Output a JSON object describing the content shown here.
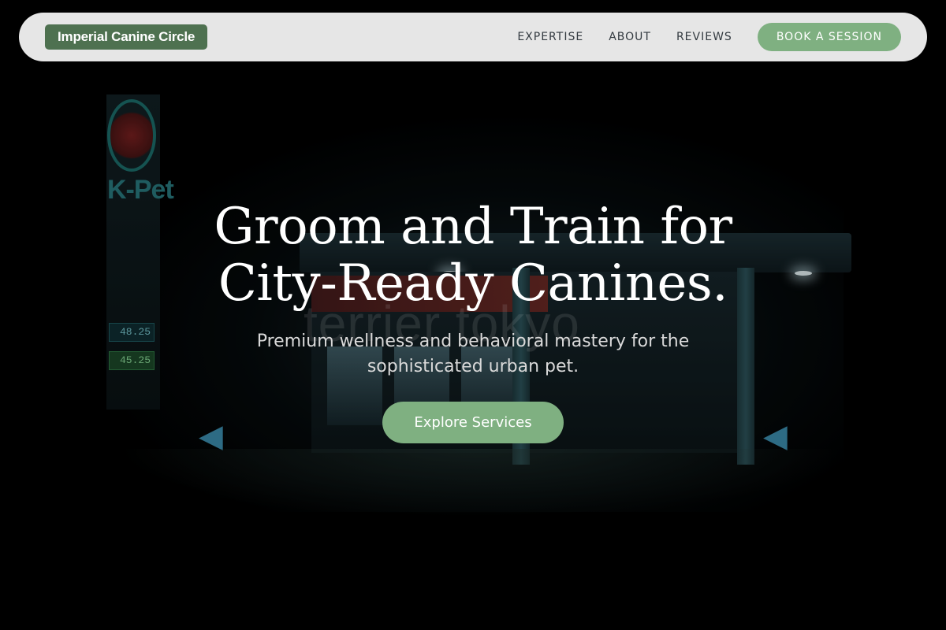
{
  "brand": {
    "name": "Imperial Canine Circle",
    "color": "#4e7150"
  },
  "nav": {
    "links": [
      "EXPERTISE",
      "ABOUT",
      "REVIEWS"
    ],
    "cta_label": "BOOK A SESSION"
  },
  "hero": {
    "title": "Groom and Train for City-Ready Canines.",
    "subtitle": "Premium wellness and behavioral mastery for the sophisticated urban pet.",
    "cta_label": "Explore Services",
    "background": {
      "sign_text": "K-Pet",
      "watermark_text": "terrier tokyo",
      "prices": [
        "48.25",
        "45.25"
      ]
    }
  },
  "colors": {
    "accent": "#7fb081",
    "navbar_bg": "#e6e6e6",
    "page_bg": "#000000"
  }
}
